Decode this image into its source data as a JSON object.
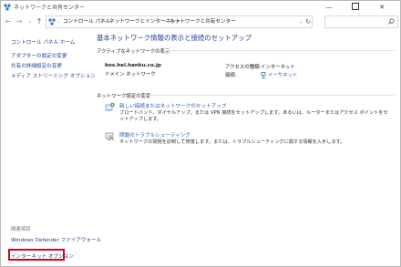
{
  "window": {
    "title": "ネットワークと共有センター",
    "min_glyph": "—",
    "close_glyph": "✕"
  },
  "nav": {
    "back_glyph": "←",
    "forward_glyph": "→",
    "dropdown_glyph": "⌄",
    "up_glyph": "↑",
    "breadcrumbs": [
      "コントロール パネル",
      "ネットワークとインターネット",
      "ネットワークと共有センター"
    ],
    "separator": "›",
    "leading_separator": "›",
    "addr_dropdown": "⌄",
    "refresh_glyph": "↻",
    "search_placeholder": ""
  },
  "sidebar": {
    "home": "コントロール パネル ホーム",
    "links": [
      "アダプターの設定の変更",
      "共有の詳細設定の変更",
      "メディア ストリーミング オプション"
    ],
    "related_heading": "関連項目",
    "related": [
      "Windows Defender ファイアウォール",
      "インターネット オプション"
    ]
  },
  "main": {
    "title": "基本ネットワーク情報の表示と接続のセットアップ",
    "active_label": "アクティブなネットワークの表示",
    "network": {
      "name": "bos.hel.hanku.co.jp",
      "category": "ドメイン ネットワーク",
      "access_type_label": "アクセスの種類:",
      "access_type_value": "インターネット",
      "connection_label": "接続:",
      "connection_value": "イーサネット"
    },
    "change_label": "ネットワーク設定の変更",
    "tasks": [
      {
        "link": "新しい接続またはネットワークのセットアップ",
        "desc": "ブロードバンド、ダイヤルアップ、または VPN 接続をセットアップします。あるいは、ルーターまたはアクセス ポイントをセ",
        "desc2": "ットアップします。"
      },
      {
        "link": "問題のトラブルシューティング",
        "desc": "ネットワークの問題を診断して修復します。または、トラブルシューティングに関する情報を入手します。"
      }
    ]
  },
  "colors": {
    "link": "#1d5fb3",
    "heading": "#1f3f8f",
    "highlight": "#d9001b"
  }
}
